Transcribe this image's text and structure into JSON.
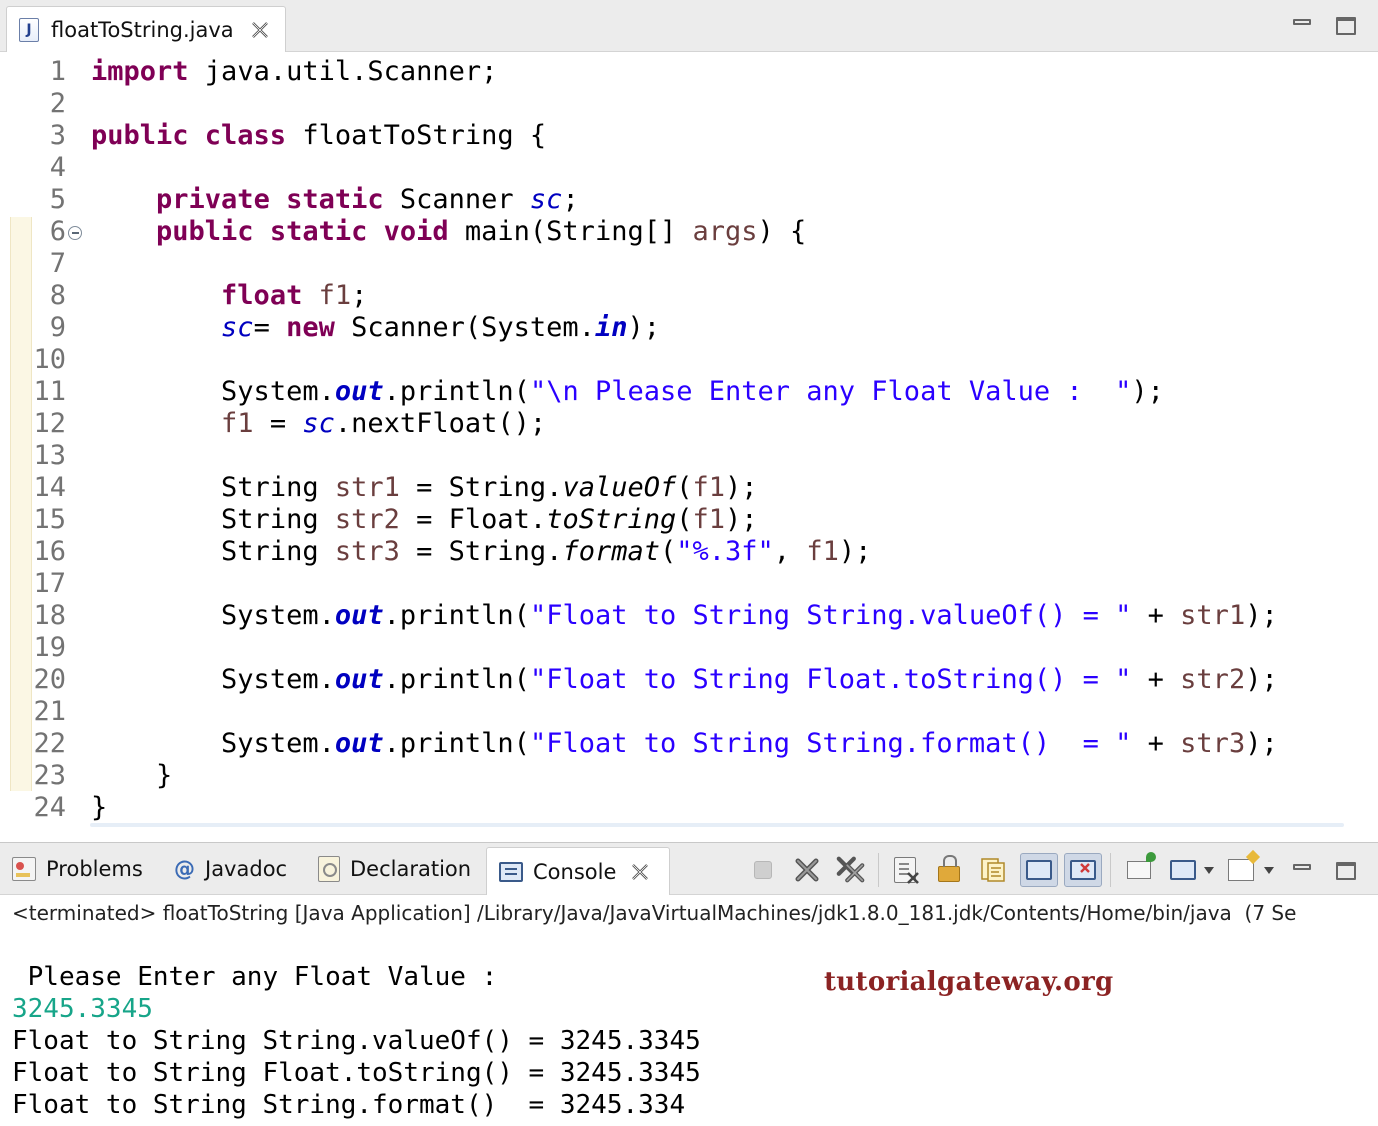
{
  "editor_tab": {
    "icon": "J",
    "label": "floatToString.java"
  },
  "line_numbers": [
    "1",
    "2",
    "3",
    "4",
    "5",
    "6",
    "7",
    "8",
    "9",
    "10",
    "11",
    "12",
    "13",
    "14",
    "15",
    "16",
    "17",
    "18",
    "19",
    "20",
    "21",
    "22",
    "23",
    "24"
  ],
  "code": {
    "l1": {
      "kw": "import",
      "rest": " java.util.Scanner;"
    },
    "l3": {
      "kw": "public class",
      "rest": " floatToString {"
    },
    "l5": {
      "indent": "    ",
      "kw": "private static",
      "type": " Scanner ",
      "field": "sc",
      "end": ";"
    },
    "l6": {
      "indent": "    ",
      "kw": "public static void",
      "pre": " main(String[] ",
      "param": "args",
      "end": ") {"
    },
    "l8": {
      "indent": "        ",
      "kw": "float",
      "sp": " ",
      "var": "f1",
      "end": ";"
    },
    "l9": {
      "indent": "        ",
      "field": "sc",
      "eq": "= ",
      "kw": "new",
      "pre": " Scanner(System.",
      "sfield": "in",
      "end": ");"
    },
    "l11": {
      "indent": "        ",
      "pre": "System.",
      "sfield": "out",
      "mid": ".println(",
      "str": "\"\\n Please Enter any Float Value :  \"",
      "end": ");"
    },
    "l12": {
      "indent": "        ",
      "var": "f1",
      "eq": " = ",
      "field": "sc",
      "end": ".nextFloat();"
    },
    "l14": {
      "indent": "        ",
      "type": "String ",
      "var": "str1",
      "mid": " = String.",
      "method": "valueOf",
      "open": "(",
      "arg": "f1",
      "end": ");"
    },
    "l15": {
      "indent": "        ",
      "type": "String ",
      "var": "str2",
      "mid": " = Float.",
      "method": "toString",
      "open": "(",
      "arg": "f1",
      "end": ");"
    },
    "l16": {
      "indent": "        ",
      "type": "String ",
      "var": "str3",
      "mid": " = String.",
      "method": "format",
      "open": "(",
      "str": "\"%.3f\"",
      "comma": ", ",
      "arg": "f1",
      "end": ");"
    },
    "l18": {
      "indent": "        ",
      "pre": "System.",
      "sfield": "out",
      "mid": ".println(",
      "str": "\"Float to String String.valueOf() = \"",
      "plus": " + ",
      "var": "str1",
      "end": ");"
    },
    "l20": {
      "indent": "        ",
      "pre": "System.",
      "sfield": "out",
      "mid": ".println(",
      "str": "\"Float to String Float.toString() = \"",
      "plus": " + ",
      "var": "str2",
      "end": ");"
    },
    "l22": {
      "indent": "        ",
      "pre": "System.",
      "sfield": "out",
      "mid": ".println(",
      "str": "\"Float to String String.format()  = \"",
      "plus": " + ",
      "var": "str3",
      "end": ");"
    },
    "l23": {
      "text": "    }"
    },
    "l24": {
      "text": "}"
    }
  },
  "panel_tabs": {
    "problems": "Problems",
    "javadoc_symbol": "@",
    "javadoc": "Javadoc",
    "declaration": "Declaration",
    "console": "Console"
  },
  "console": {
    "status": "<terminated> floatToString [Java Application] /Library/Java/JavaVirtualMachines/jdk1.8.0_181.jdk/Contents/Home/bin/java  (7 Se",
    "prompt": " Please Enter any Float Value :  ",
    "user_input": "3245.3345",
    "out1": "Float to String String.valueOf() = 3245.3345",
    "out2": "Float to String Float.toString() = 3245.3345",
    "out3": "Float to String String.format()  = 3245.334"
  },
  "watermark": "tutorialgateway.org",
  "icons": {
    "editor_tab": "java-file-icon",
    "close": "close-icon",
    "minimize": "minimize-icon",
    "maximize": "maximize-icon",
    "fold": "collapse-icon",
    "toolbar": [
      "terminate-icon",
      "remove-launch-icon",
      "remove-all-terminated-icon",
      "clear-console-icon",
      "scroll-lock-icon",
      "word-wrap-icon",
      "show-on-stdout-icon",
      "show-on-stderr-icon",
      "pin-console-icon",
      "display-console-icon",
      "open-console-icon"
    ]
  },
  "colors": {
    "keyword": "#7f0055",
    "string": "#2a00ff",
    "local_variable": "#6a3e3e",
    "field": "#0000c0",
    "user_input": "#17a589",
    "watermark": "#8b2323"
  }
}
